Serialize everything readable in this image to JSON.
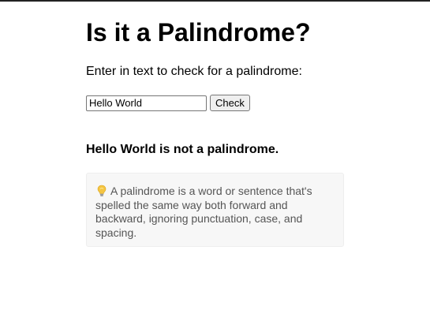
{
  "page": {
    "title": "Is it a Palindrome?",
    "prompt": "Enter in text to check for a palindrome:"
  },
  "form": {
    "input_value": "Hello World",
    "button_label": "Check"
  },
  "result": {
    "text": "Hello World is not a palindrome."
  },
  "info": {
    "icon": "lightbulb-icon",
    "text": "A palindrome is a word or sentence that's spelled the same way both forward and backward, ignoring punctuation, case, and spacing."
  },
  "colors": {
    "info_background": "#f7f7f7",
    "info_text": "#555555",
    "bulb": "#f5c542"
  }
}
